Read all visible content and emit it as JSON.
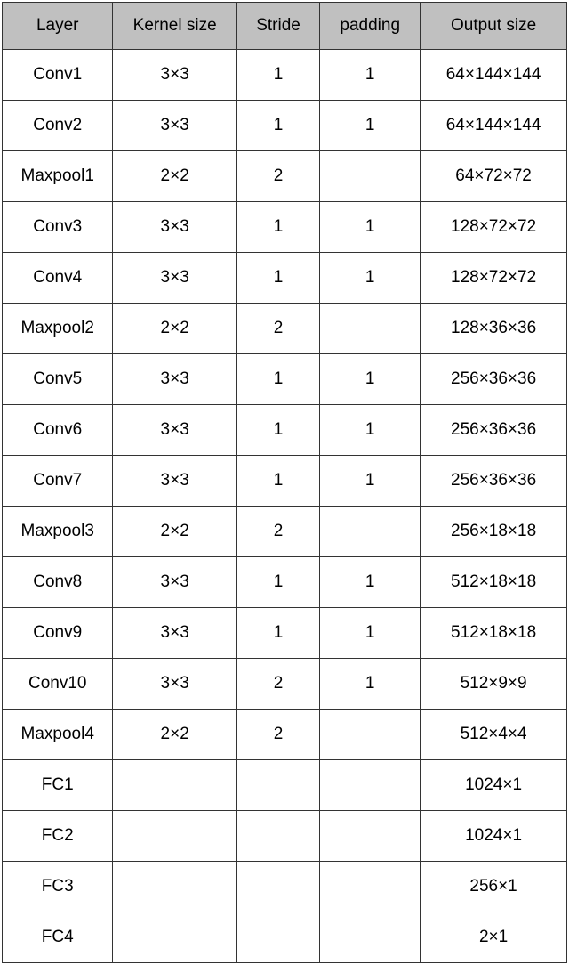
{
  "chart_data": {
    "type": "table",
    "headers": [
      "Layer",
      "Kernel size",
      "Stride",
      "padding",
      "Output size"
    ],
    "rows": [
      {
        "layer": "Conv1",
        "kernel": "3×3",
        "stride": "1",
        "padding": "1",
        "output": "64×144×144"
      },
      {
        "layer": "Conv2",
        "kernel": "3×3",
        "stride": "1",
        "padding": "1",
        "output": "64×144×144"
      },
      {
        "layer": "Maxpool1",
        "kernel": "2×2",
        "stride": "2",
        "padding": "",
        "output": "64×72×72"
      },
      {
        "layer": "Conv3",
        "kernel": "3×3",
        "stride": "1",
        "padding": "1",
        "output": "128×72×72"
      },
      {
        "layer": "Conv4",
        "kernel": "3×3",
        "stride": "1",
        "padding": "1",
        "output": "128×72×72"
      },
      {
        "layer": "Maxpool2",
        "kernel": "2×2",
        "stride": "2",
        "padding": "",
        "output": "128×36×36"
      },
      {
        "layer": "Conv5",
        "kernel": "3×3",
        "stride": "1",
        "padding": "1",
        "output": "256×36×36"
      },
      {
        "layer": "Conv6",
        "kernel": "3×3",
        "stride": "1",
        "padding": "1",
        "output": "256×36×36"
      },
      {
        "layer": "Conv7",
        "kernel": "3×3",
        "stride": "1",
        "padding": "1",
        "output": "256×36×36"
      },
      {
        "layer": "Maxpool3",
        "kernel": "2×2",
        "stride": "2",
        "padding": "",
        "output": "256×18×18"
      },
      {
        "layer": "Conv8",
        "kernel": "3×3",
        "stride": "1",
        "padding": "1",
        "output": "512×18×18"
      },
      {
        "layer": "Conv9",
        "kernel": "3×3",
        "stride": "1",
        "padding": "1",
        "output": "512×18×18"
      },
      {
        "layer": "Conv10",
        "kernel": "3×3",
        "stride": "2",
        "padding": "1",
        "output": "512×9×9"
      },
      {
        "layer": "Maxpool4",
        "kernel": "2×2",
        "stride": "2",
        "padding": "",
        "output": "512×4×4"
      },
      {
        "layer": "FC1",
        "kernel": "",
        "stride": "",
        "padding": "",
        "output": "1024×1"
      },
      {
        "layer": "FC2",
        "kernel": "",
        "stride": "",
        "padding": "",
        "output": "1024×1"
      },
      {
        "layer": "FC3",
        "kernel": "",
        "stride": "",
        "padding": "",
        "output": "256×1"
      },
      {
        "layer": "FC4",
        "kernel": "",
        "stride": "",
        "padding": "",
        "output": "2×1"
      }
    ]
  }
}
